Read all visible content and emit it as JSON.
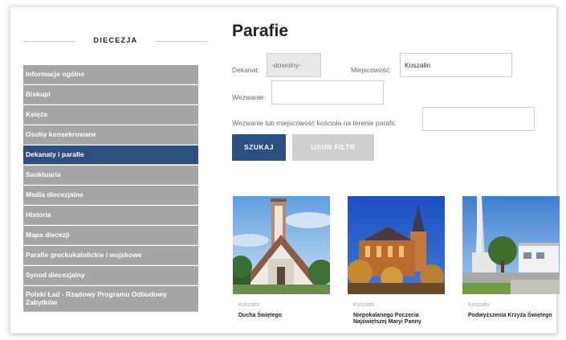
{
  "sidebar": {
    "title": "DIECEZJA",
    "items": [
      {
        "label": "Informacje ogólne"
      },
      {
        "label": "Biskupi"
      },
      {
        "label": "Księża"
      },
      {
        "label": "Osoby konsekrowane"
      },
      {
        "label": "Dekanaty i parafie",
        "active": true
      },
      {
        "label": "Sanktuaria"
      },
      {
        "label": "Media diecezjalne"
      },
      {
        "label": "Historia"
      },
      {
        "label": "Mapa diecezji"
      },
      {
        "label": "Parafie greckokatolickie i wojskowe"
      },
      {
        "label": "Synod diecezjalny"
      },
      {
        "label": "Polski Ład - Rządowy Programu Odbudowy Zabytków"
      }
    ]
  },
  "main": {
    "title": "Parafie",
    "filters": {
      "dekanat_label": "Dekanat:",
      "dekanat_value": "-dowolny-",
      "miejscowosc_label": "Miejscowość:",
      "miejscowosc_value": "Koszalin",
      "wezwanie_label": "Wezwanie:",
      "wezwanie_value": "",
      "combined_label": "Wezwanie lub miejscowość kościoła na terenie parafii:",
      "combined_value": ""
    },
    "buttons": {
      "search": "SZUKAJ",
      "clear": "USUŃ FILTR"
    },
    "cards": [
      {
        "city": "Koszalin",
        "name": "Ducha Świętego"
      },
      {
        "city": "Koszalin",
        "name": "Niepokalanego Poczęcia Najświętszej Maryi Panny"
      },
      {
        "city": "Koszalin",
        "name": "Podwyższenia Krzyża Świętego"
      }
    ]
  },
  "colors": {
    "accent": "#2b4f80",
    "menu_bg": "#a5a5a5",
    "clear_button": "#cfcfcf"
  }
}
